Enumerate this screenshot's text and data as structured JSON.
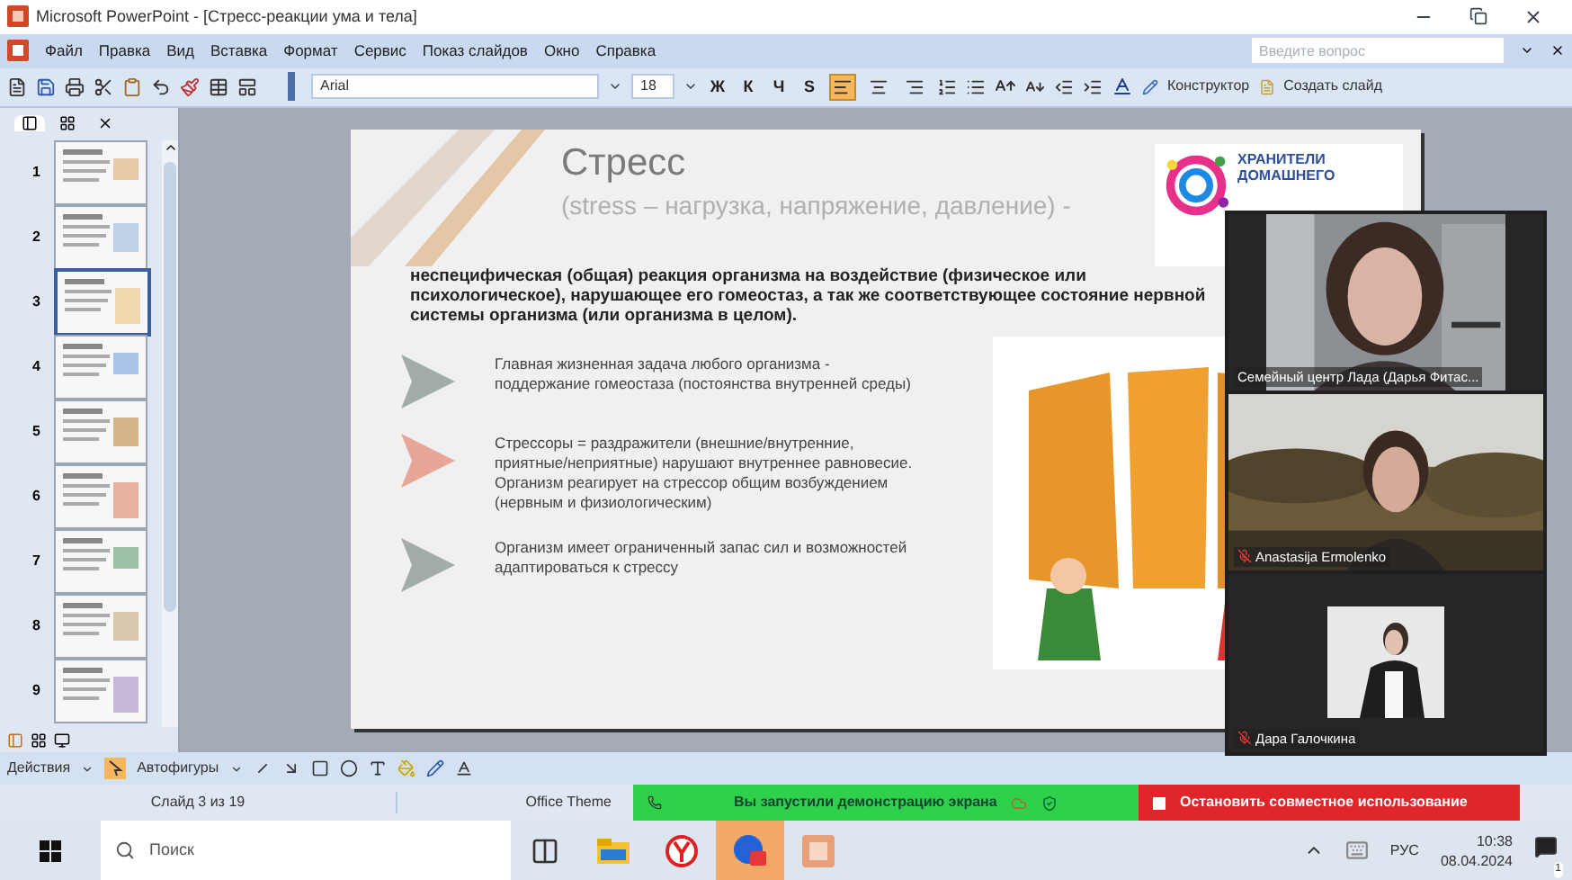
{
  "window": {
    "title": "Microsoft PowerPoint - [Стресс-реакции ума и тела]"
  },
  "menu": [
    "Файл",
    "Правка",
    "Вид",
    "Вставка",
    "Формат",
    "Сервис",
    "Показ слайдов",
    "Окно",
    "Справка"
  ],
  "help_search": {
    "placeholder": "Введите вопрос"
  },
  "toolbar": {
    "font": "Arial",
    "size": "18",
    "format_buttons": [
      "Ж",
      "К",
      "Ч",
      "S"
    ],
    "align_buttons": [
      {
        "selected": true
      },
      {
        "selected": false
      },
      {
        "selected": false
      }
    ],
    "designer": "Конструктор",
    "new_slide": "Создать слайд"
  },
  "slide_pane": {
    "slides": [
      {
        "number": "1",
        "selected": false
      },
      {
        "number": "2",
        "selected": false
      },
      {
        "number": "3",
        "selected": true
      },
      {
        "number": "4",
        "selected": false
      },
      {
        "number": "5",
        "selected": false
      },
      {
        "number": "6",
        "selected": false
      },
      {
        "number": "7",
        "selected": false
      },
      {
        "number": "8",
        "selected": false
      },
      {
        "number": "9",
        "selected": false
      }
    ]
  },
  "slide": {
    "title": "Стресс",
    "subtitle": "(stress – нагрузка, напряжение, давление) -",
    "logo": [
      "ХРАНИТЕЛИ",
      "ДОМАШНЕГО"
    ],
    "definition": "неспецифическая (общая) реакция организма на воздействие (физическое или психологическое), нарушающее его гомеостаз, а так же соответствующее состояние нервной системы организма (или организма в целом).",
    "bullets": [
      {
        "text": "Главная жизненная задача любого организма - поддержание гомеостаза (постоянства внутренней среды)",
        "color": "#a3acab"
      },
      {
        "text": "Стрессоры = раздражители (внешние/внутренние, приятные/неприятные) нарушают внутреннее равновесие. Организм реагирует на стрессор общим возбуждением (нервным и физиологическим)",
        "color": "#e8a698"
      },
      {
        "text": "Организм имеет ограниченный запас сил и возможностей адаптироваться к стрессу",
        "color": "#a3acab"
      }
    ]
  },
  "video_panel": {
    "participants": [
      {
        "name": "Семейный центр Лада (Дарья Фитас...",
        "muted": false
      },
      {
        "name": "Anastasija Ermolenko",
        "muted": true
      },
      {
        "name": "Дара Галочкина",
        "muted": true
      }
    ]
  },
  "drawing_toolbar": {
    "actions": "Действия",
    "autoshapes": "Автофигуры"
  },
  "status_bar": {
    "slide": "Слайд 3 из 19",
    "theme": "Office Theme",
    "sharing": "Вы запустили демонстрацию экрана",
    "stop": "Остановить совместное использование"
  },
  "taskbar": {
    "search": {
      "placeholder": "Поиск"
    },
    "apps": [
      {
        "kind": "taskview",
        "selected": false
      },
      {
        "kind": "folder",
        "selected": false
      },
      {
        "kind": "browser",
        "selected": false
      },
      {
        "kind": "meeting",
        "selected": true
      },
      {
        "kind": "slides",
        "selected": false
      }
    ],
    "language": "РУС",
    "time": "10:38",
    "date": "08.04.2024",
    "badge": "1"
  }
}
